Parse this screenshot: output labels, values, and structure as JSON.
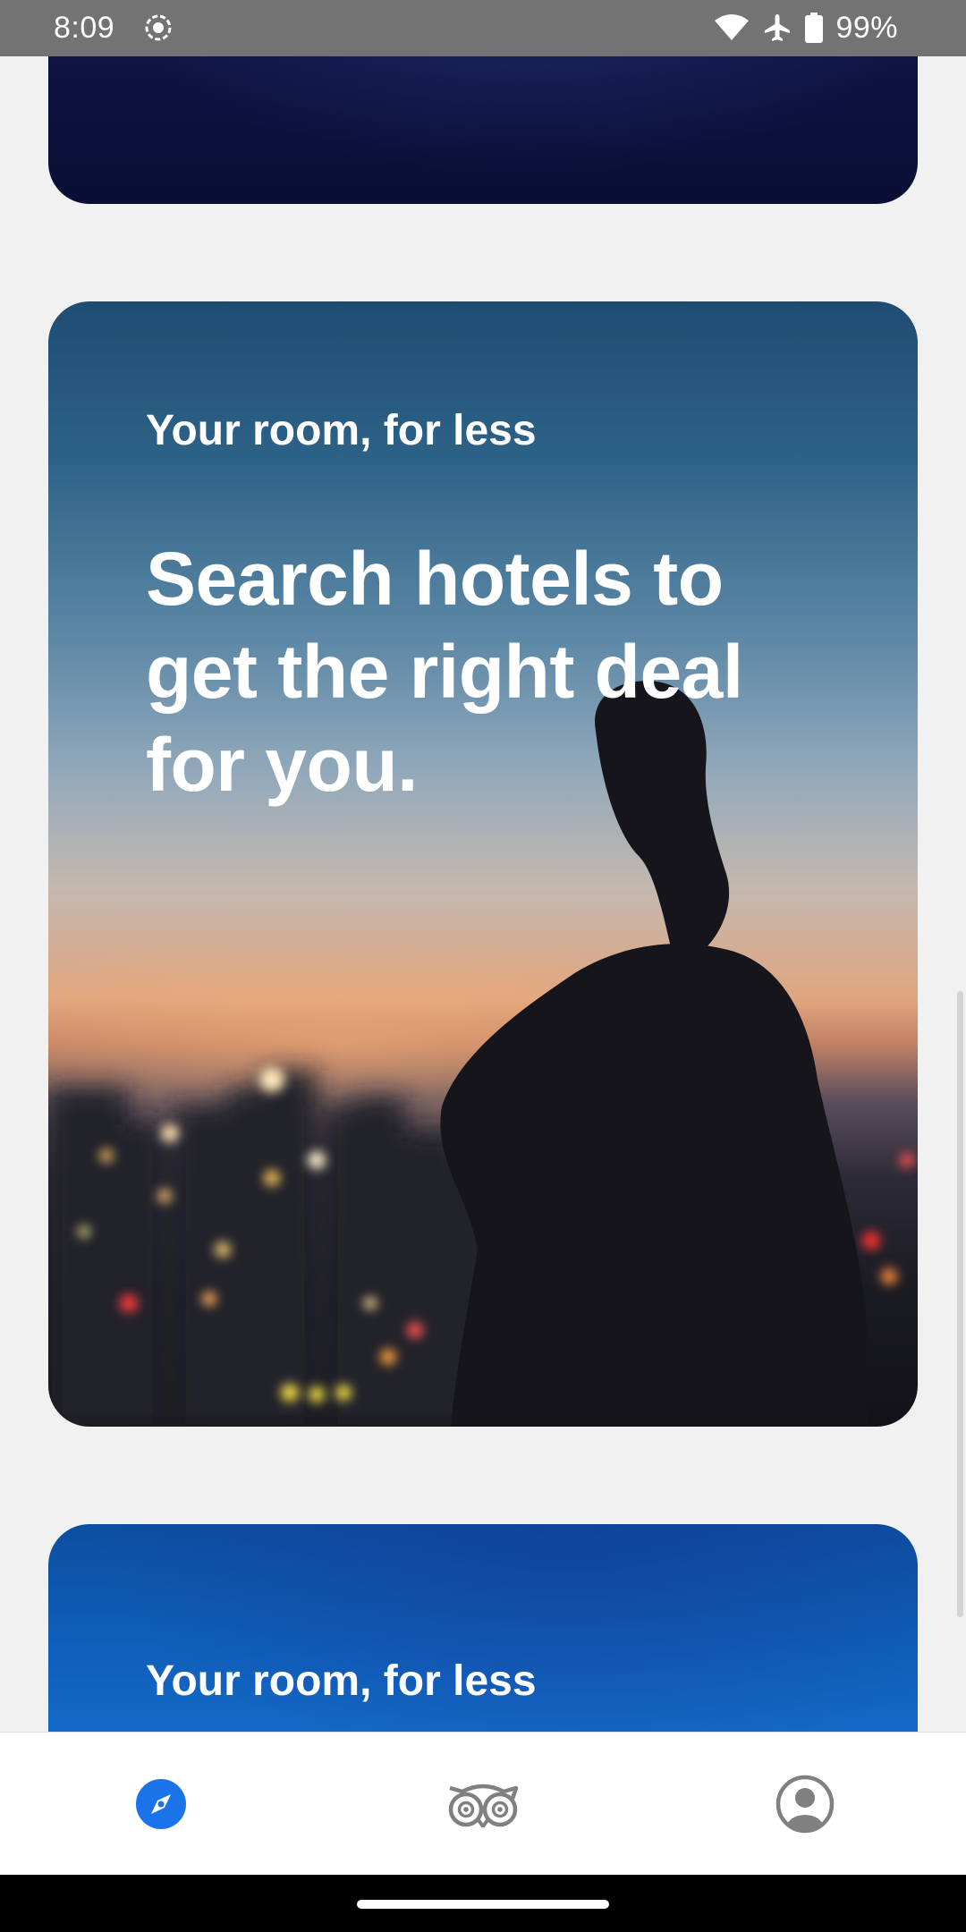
{
  "status_bar": {
    "time": "8:09",
    "battery_percent": "99%",
    "icons": [
      "screen-record-icon",
      "wifi-icon",
      "airplane-mode-icon",
      "battery-icon"
    ]
  },
  "cards": [
    {
      "eyebrow": "Your room, for less",
      "headline": "Search hotels to get the right deal for you."
    },
    {
      "eyebrow": "Your room, for less"
    }
  ],
  "bottom_nav": {
    "tabs": [
      {
        "icon": "compass-icon",
        "selected": true
      },
      {
        "icon": "owl-logo-icon",
        "selected": false
      },
      {
        "icon": "account-icon",
        "selected": false
      }
    ]
  },
  "colors": {
    "accent": "#1a73e8",
    "status_bar": "#737373",
    "background": "#f1f1f1",
    "nav_icon_inactive": "#808080"
  }
}
